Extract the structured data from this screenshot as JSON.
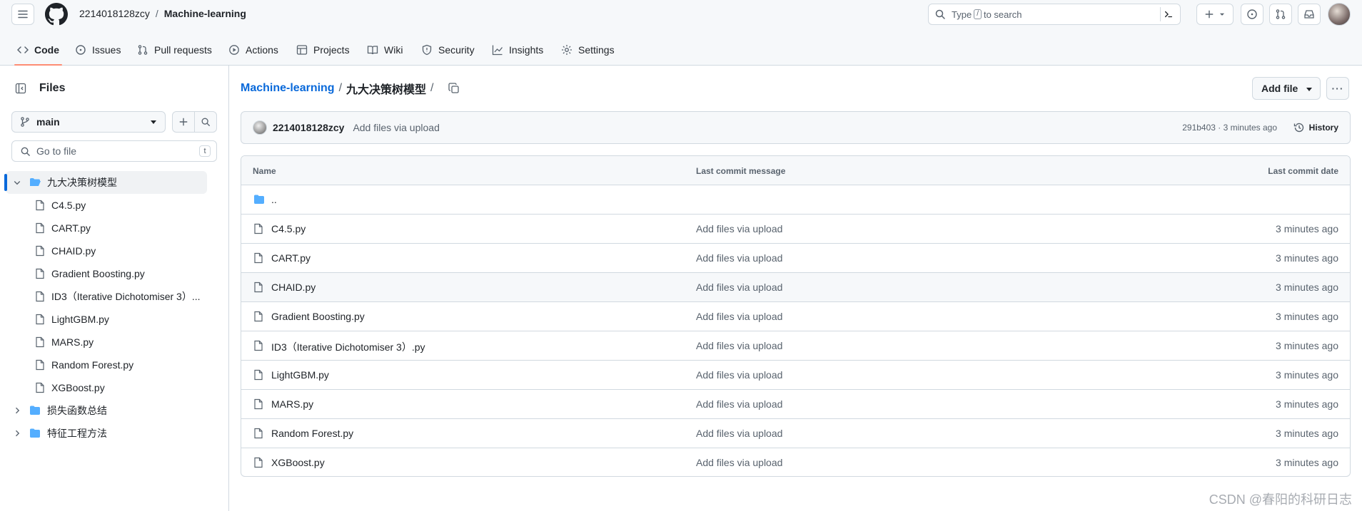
{
  "header": {
    "owner": "2214018128zcy",
    "separator": "/",
    "repo": "Machine-learning",
    "search": {
      "prefix": "Type",
      "key": "/",
      "suffix": "to search"
    },
    "tabs": [
      {
        "label": "Code",
        "icon": "code-icon",
        "active": true
      },
      {
        "label": "Issues",
        "icon": "issue-icon"
      },
      {
        "label": "Pull requests",
        "icon": "pull-request-icon"
      },
      {
        "label": "Actions",
        "icon": "play-icon"
      },
      {
        "label": "Projects",
        "icon": "table-icon"
      },
      {
        "label": "Wiki",
        "icon": "book-icon"
      },
      {
        "label": "Security",
        "icon": "shield-icon"
      },
      {
        "label": "Insights",
        "icon": "graph-icon"
      },
      {
        "label": "Settings",
        "icon": "gear-icon"
      }
    ]
  },
  "sidebar": {
    "title": "Files",
    "branch": "main",
    "goto_placeholder": "Go to file",
    "goto_key": "t",
    "tree": [
      {
        "label": "九大决策树模型",
        "type": "folder-open",
        "level": 0,
        "selected": true
      },
      {
        "label": "C4.5.py",
        "type": "file",
        "level": 1
      },
      {
        "label": "CART.py",
        "type": "file",
        "level": 1
      },
      {
        "label": "CHAID.py",
        "type": "file",
        "level": 1
      },
      {
        "label": "Gradient Boosting.py",
        "type": "file",
        "level": 1
      },
      {
        "label": "ID3（Iterative Dichotomiser 3）...",
        "type": "file",
        "level": 1
      },
      {
        "label": "LightGBM.py",
        "type": "file",
        "level": 1
      },
      {
        "label": "MARS.py",
        "type": "file",
        "level": 1
      },
      {
        "label": "Random Forest.py",
        "type": "file",
        "level": 1
      },
      {
        "label": "XGBoost.py",
        "type": "file",
        "level": 1
      },
      {
        "label": "损失函数总结",
        "type": "folder",
        "level": 0
      },
      {
        "label": "特征工程方法",
        "type": "folder",
        "level": 0
      }
    ]
  },
  "main": {
    "path_root": "Machine-learning",
    "path_sep": "/",
    "path_dir": "九大决策树模型",
    "path_trail": "/",
    "add_file": "Add file",
    "more": "···",
    "commit": {
      "author": "2214018128zcy",
      "message": "Add files via upload",
      "meta": "291b403 · 3 minutes ago",
      "history": "History"
    },
    "columns": {
      "name": "Name",
      "message": "Last commit message",
      "date": "Last commit date"
    },
    "parent_dir": "..",
    "files": [
      {
        "name": "C4.5.py",
        "message": "Add files via upload",
        "date": "3 minutes ago"
      },
      {
        "name": "CART.py",
        "message": "Add files via upload",
        "date": "3 minutes ago"
      },
      {
        "name": "CHAID.py",
        "message": "Add files via upload",
        "date": "3 minutes ago"
      },
      {
        "name": "Gradient Boosting.py",
        "message": "Add files via upload",
        "date": "3 minutes ago"
      },
      {
        "name": "ID3（Iterative Dichotomiser 3）.py",
        "message": "Add files via upload",
        "date": "3 minutes ago"
      },
      {
        "name": "LightGBM.py",
        "message": "Add files via upload",
        "date": "3 minutes ago"
      },
      {
        "name": "MARS.py",
        "message": "Add files via upload",
        "date": "3 minutes ago"
      },
      {
        "name": "Random Forest.py",
        "message": "Add files via upload",
        "date": "3 minutes ago"
      },
      {
        "name": "XGBoost.py",
        "message": "Add files via upload",
        "date": "3 minutes ago"
      }
    ]
  },
  "watermark": "CSDN @春阳的科研日志",
  "colors": {
    "accent": "#0969da",
    "tab_underline": "#fd8c73",
    "folder": "#54aeff",
    "muted": "#59636e",
    "border": "#d1d9e0"
  }
}
